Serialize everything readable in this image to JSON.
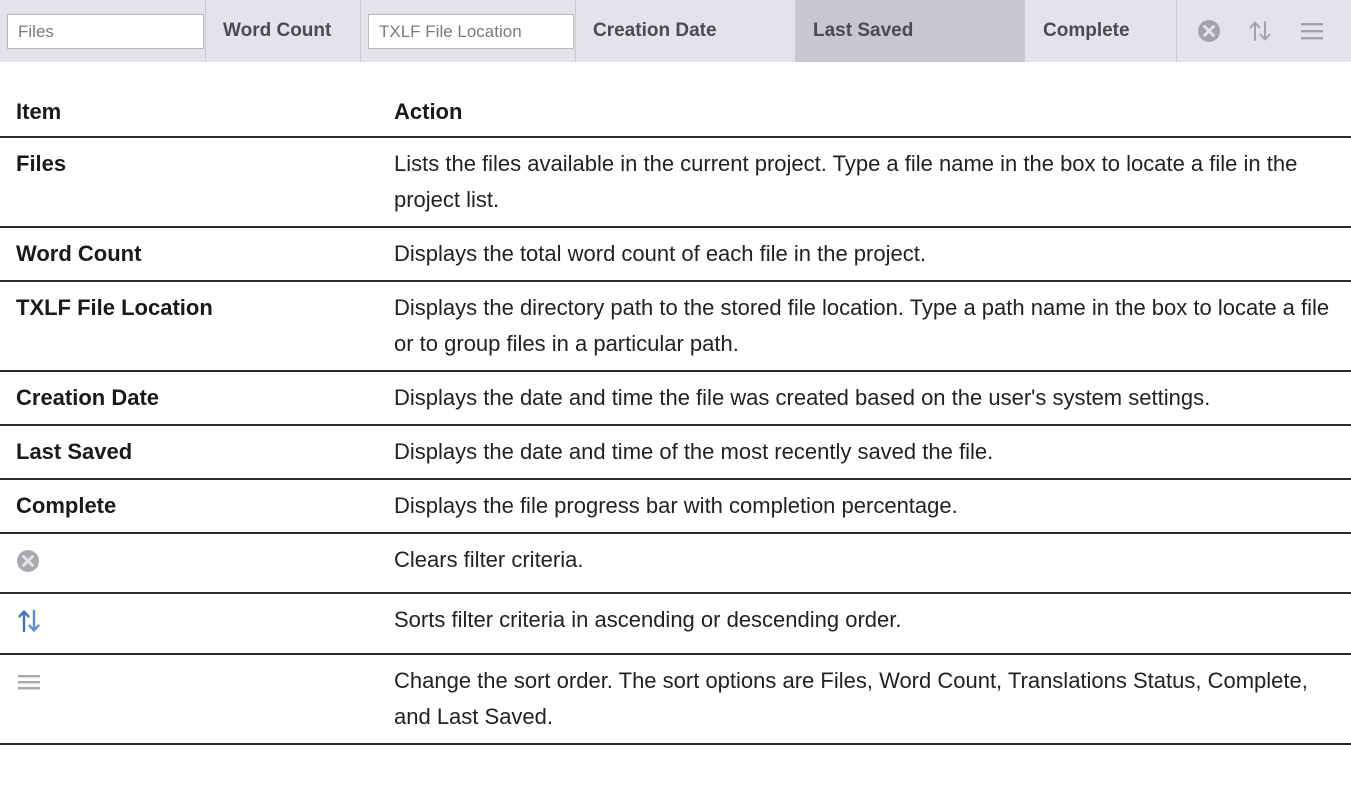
{
  "toolbar": {
    "files_placeholder": "Files",
    "word_count": "Word Count",
    "txlf_placeholder": "TXLF File Location",
    "creation_date": "Creation Date",
    "last_saved": "Last Saved",
    "complete": "Complete",
    "icons": [
      "clear-filter-icon",
      "sort-toggle-icon",
      "menu-icon"
    ],
    "colors": {
      "bar": "#e4e4e8",
      "active_column": "#c7c7cc",
      "sort_icon_blue": "#4a7fc0"
    }
  },
  "table": {
    "headers": {
      "item": "Item",
      "action": "Action"
    },
    "rows": [
      {
        "item": "Files",
        "action": "Lists the files available in the current project. Type a file name in the box to locate a file in the project list."
      },
      {
        "item": "Word Count",
        "action": "Displays the total word count of each file in the project."
      },
      {
        "item": "TXLF File Location",
        "action": "Displays the directory path to the stored file location. Type a path name in the box to locate a file or to group files in a particular path."
      },
      {
        "item": "Creation Date",
        "action": "Displays the date and time the file was created based on the user's system settings."
      },
      {
        "item": "Last Saved",
        "action": "Displays the date and time of the most recently saved the file."
      },
      {
        "item": "Complete",
        "action": "Displays the file progress bar with completion percentage."
      },
      {
        "icon": "clear-filter-icon",
        "action": "Clears filter criteria."
      },
      {
        "icon": "sort-toggle-icon",
        "action": "Sorts filter criteria in ascending or descending order."
      },
      {
        "icon": "menu-icon",
        "action": "Change the sort order. The sort options are Files, Word Count, Translations Status, Complete, and Last Saved."
      }
    ]
  }
}
